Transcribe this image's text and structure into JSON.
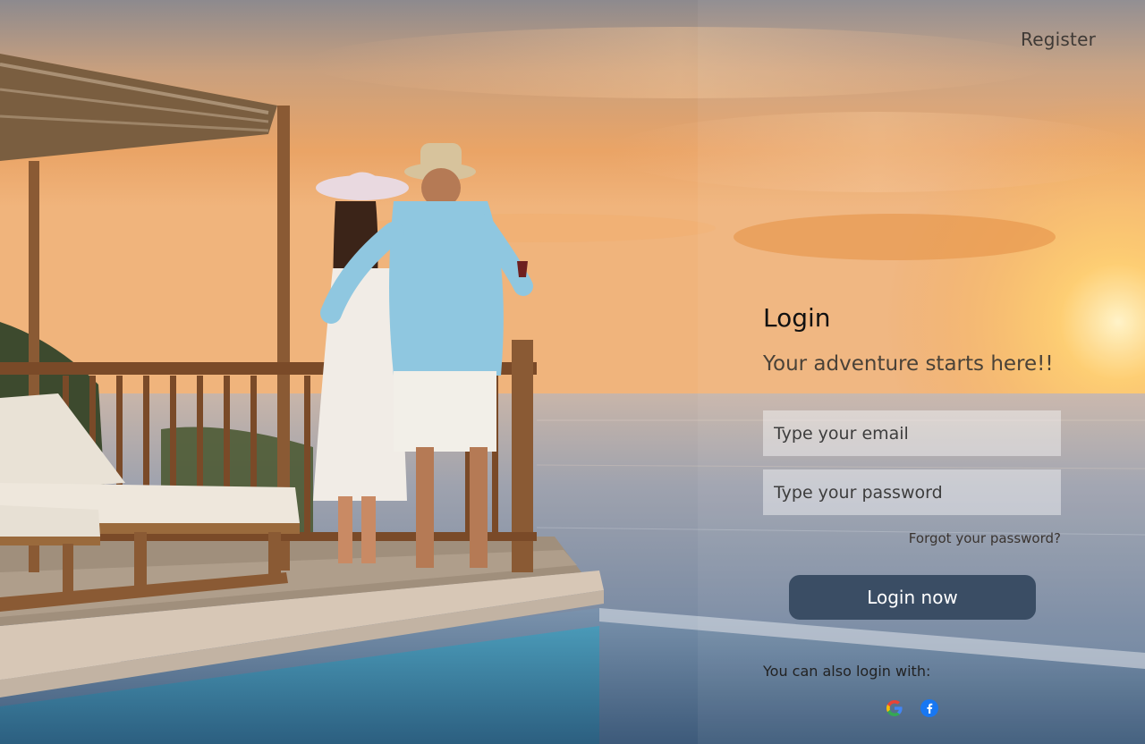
{
  "nav": {
    "register_label": "Register"
  },
  "login": {
    "title": "Login",
    "tagline": "Your adventure starts here!!",
    "email_placeholder": "Type your email",
    "password_placeholder": "Type your password",
    "forgot_label": "Forgot your password?",
    "submit_label": "Login now",
    "alt_login_text": "You can also login with:",
    "social_providers": [
      {
        "icon": "google-icon"
      },
      {
        "icon": "facebook-icon"
      }
    ]
  },
  "colors": {
    "button_bg": "#3a4d64",
    "button_text": "#ffffff",
    "sunset_orange": "#f2a04a",
    "sea_blue": "#7c8fa8"
  }
}
